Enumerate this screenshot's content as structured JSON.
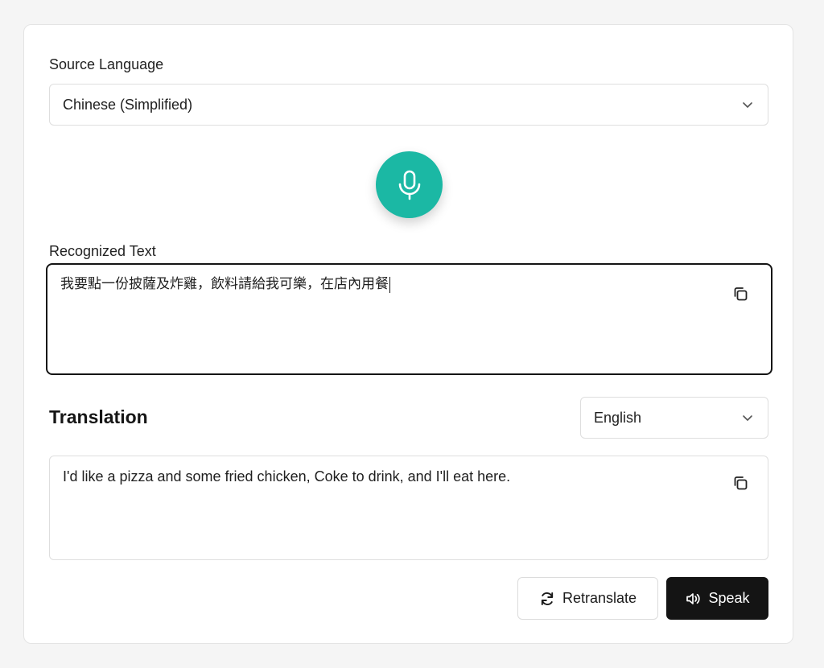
{
  "source": {
    "label": "Source Language",
    "selected": "Chinese (Simplified)"
  },
  "mic": {
    "icon": "microphone-icon",
    "accent": "#1bb8a4"
  },
  "recognized": {
    "label": "Recognized Text",
    "value": "我要點一份披薩及炸雞，飲料請給我可樂，在店內用餐"
  },
  "translation": {
    "heading": "Translation",
    "target_language": "English",
    "value": "I'd like a pizza and some fried chicken, Coke to drink, and I'll eat here."
  },
  "actions": {
    "retranslate_label": "Retranslate",
    "speak_label": "Speak"
  }
}
